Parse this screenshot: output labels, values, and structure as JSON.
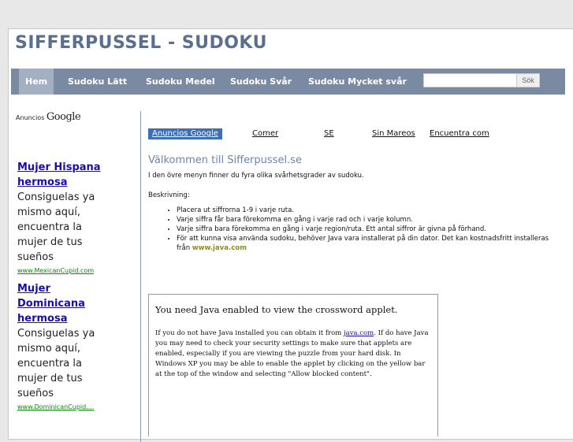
{
  "header": {
    "site_title": "SIFFERPUSSEL - SUDOKU"
  },
  "nav": {
    "items": [
      {
        "label": "Hem",
        "active": true
      },
      {
        "label": "Sudoku  Lätt"
      },
      {
        "label": "Sudoku Medel"
      },
      {
        "label": "Sudoku Svår"
      },
      {
        "label": "Sudoku Mycket svår"
      }
    ],
    "search": {
      "value": "",
      "button_label": "Sök"
    }
  },
  "sidebar": {
    "ads_label": "Anuncios",
    "ads_brand": "Google",
    "ads": [
      {
        "title": "Mujer Hispana hermosa",
        "text": "Consiguelas ya mismo aquí, encuentra la mujer de tus sueños",
        "url": "www.MexicanCupid.com"
      },
      {
        "title": "Mujer Dominicana hermosa",
        "text": "Consiguelas ya mismo aquí, encuentra la mujer de tus sueños",
        "url": "www.DominicanCupid...."
      }
    ]
  },
  "main": {
    "ad_links": {
      "google_label": "Anuncios Google",
      "links": [
        "Comer",
        "SE",
        "Sin Mareos",
        "Encuentra com"
      ]
    },
    "welcome_title": "Välkommen till Sifferpussel.se",
    "intro": "I den övre menyn finner du fyra olika svårhetsgrader av sudoku.",
    "description_label": "Beskrivning:",
    "rules": [
      "Placera ut siffrorna 1-9 i varje ruta.",
      "Varje siffra får bara förekomma en gång i varje rad och i varje kolumn.",
      "Varje siffra bara förekomma en gång i varje region/ruta. Ett antal siffror är givna på förhand."
    ],
    "java_rule_text": "För att kunna visa använda sudoku, behöver Java vara installerat på din dator. Det kan kostnadsfritt installeras från",
    "java_link": "www.java.com",
    "applet": {
      "title": "You need Java enabled to view the crossword applet.",
      "text_before_link": "If you do not have Java installed you can obtain it from",
      "link": "java.com",
      "text_after_link": ". If do have Java you may need to check your security settings to make sure that applets are enabled, especially if you are viewing the puzzle from your hard disk. In Windows XP you may be able to enable the applet by clicking on the yellow bar at the top of the window and selecting \"Allow blocked content\"."
    }
  }
}
